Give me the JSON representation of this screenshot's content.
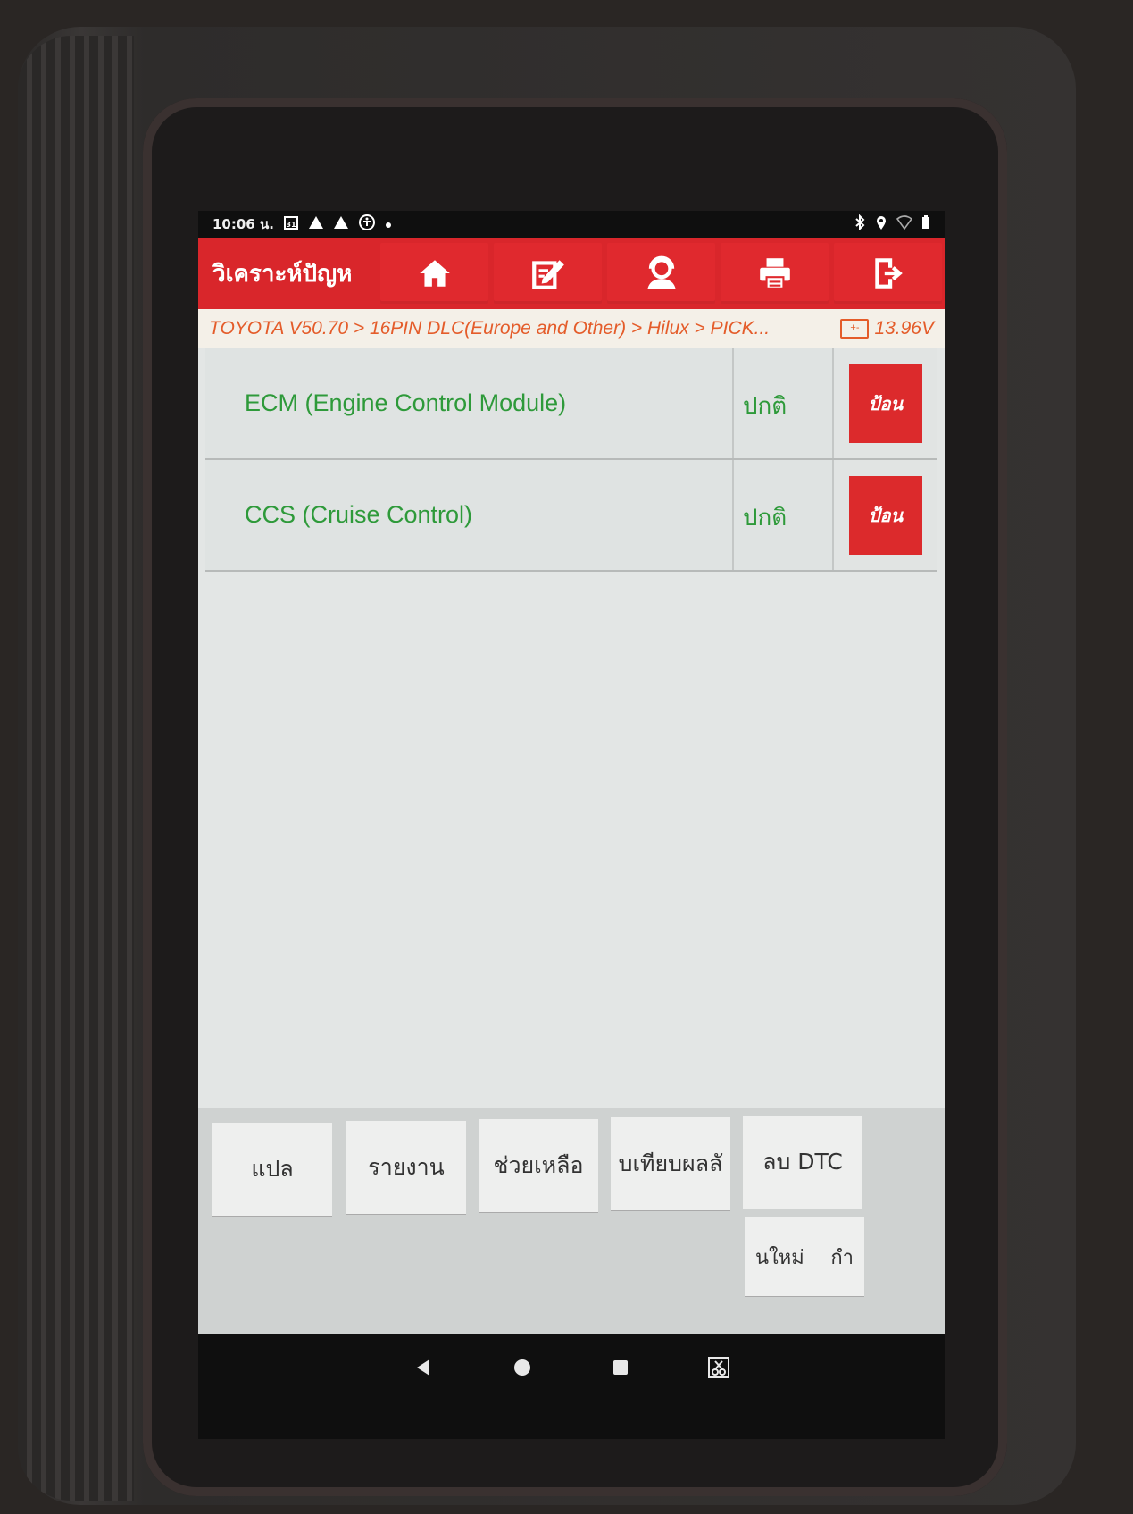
{
  "status_bar": {
    "time": "10:06 น.",
    "left_icons": [
      "calendar-icon",
      "warning-icon",
      "warning-icon",
      "accessibility-icon",
      "dot-icon"
    ],
    "right_icons": [
      "bluetooth-icon",
      "location-icon",
      "wifi-icon",
      "battery-icon"
    ]
  },
  "toolbar": {
    "title": "วิเคราะห์ปัญห",
    "buttons": [
      {
        "icon": "home-icon"
      },
      {
        "icon": "edit-icon"
      },
      {
        "icon": "user-support-icon"
      },
      {
        "icon": "print-icon"
      },
      {
        "icon": "exit-icon"
      }
    ],
    "accent": "#d9262b"
  },
  "breadcrumb": {
    "path": "TOYOTA V50.70 > 16PIN DLC(Europe and Other) > Hilux > PICK...",
    "voltage": "13.96V"
  },
  "systems": [
    {
      "name": "ECM (Engine Control Module)",
      "status": "ปกติ",
      "action": "ป้อน"
    },
    {
      "name": "CCS (Cruise Control)",
      "status": "ปกติ",
      "action": "ป้อน"
    }
  ],
  "actions": {
    "translate": "แปล",
    "report": "รายงาน",
    "help": "ช่วยเหลือ",
    "compare": "บเทียบผลลั",
    "clear_dtc": "ลบ DTC",
    "new": "นใหม่",
    "new_suffix": "กำ"
  },
  "colors": {
    "status_green": "#2e9a3a",
    "breadcrumb_orange": "#e45c2a",
    "enter_red": "#dc2a2c"
  }
}
